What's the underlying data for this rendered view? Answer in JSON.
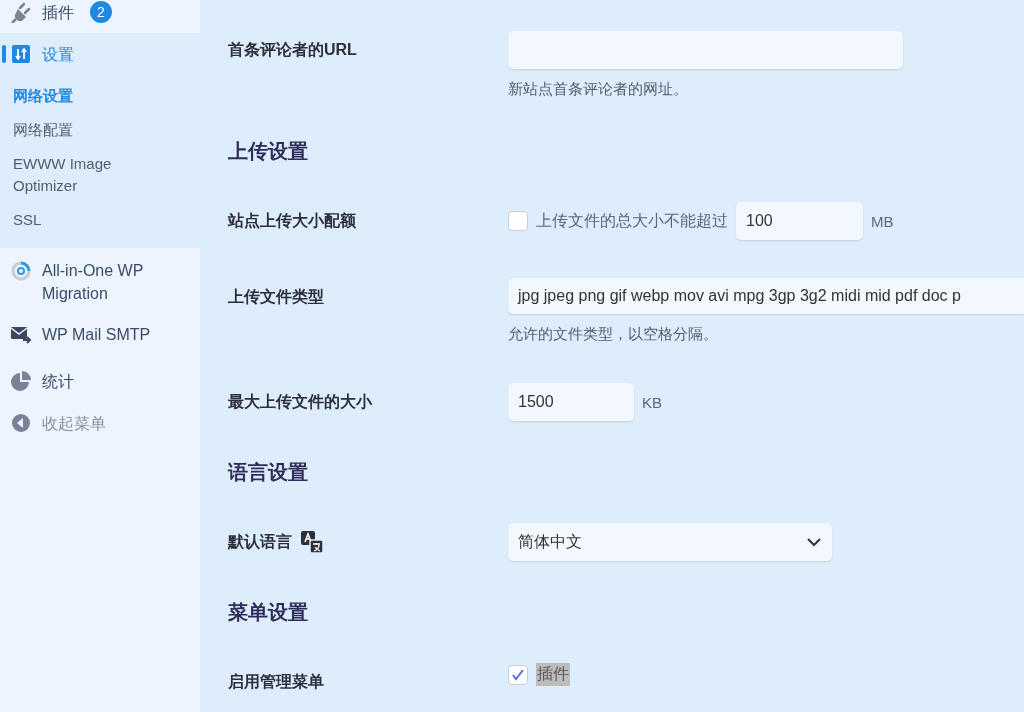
{
  "sidebar": {
    "items": [
      {
        "label": "插件",
        "badge": "2",
        "selected": false
      },
      {
        "label": "设置",
        "selected": true,
        "children": [
          {
            "label": "网络设置",
            "selected": true
          },
          {
            "label": "网络配置",
            "selected": false
          },
          {
            "label": "EWWW Image Optimizer",
            "selected": false
          },
          {
            "label": "SSL",
            "selected": false
          }
        ]
      },
      {
        "label": "All-in-One WP Migration",
        "selected": false
      },
      {
        "label": "WP Mail SMTP",
        "selected": false
      },
      {
        "label": "统计",
        "selected": false
      },
      {
        "label": "收起菜单",
        "selected": false
      }
    ]
  },
  "form": [
    {
      "kind": "text",
      "label": "首条评论者的URL",
      "hint": "新站点首条评论者的网址。"
    },
    {
      "kind": "heading",
      "label": "上传设置"
    },
    {
      "kind": "quota",
      "label": "站点上传大小配额",
      "checked": false,
      "text": "上传文件的总大小不能超过",
      "value": "100",
      "unit": "MB"
    },
    {
      "kind": "wide",
      "label": "上传文件类型",
      "value": "jpg jpeg png gif webp mov avi mpg 3gp 3g2 midi mid pdf doc p",
      "hint": "允许的文件类型，以空格分隔。"
    },
    {
      "kind": "number",
      "label": "最大上传文件的大小",
      "value": "1500",
      "unit": "KB"
    },
    {
      "kind": "heading",
      "label": "语言设置"
    },
    {
      "kind": "select",
      "label": "默认语言",
      "value": "简体中文"
    },
    {
      "kind": "heading",
      "label": "菜单设置"
    },
    {
      "kind": "checks",
      "label": "启用管理菜单",
      "options": [
        {
          "label": "插件",
          "checked": true,
          "selected": true
        }
      ]
    }
  ]
}
